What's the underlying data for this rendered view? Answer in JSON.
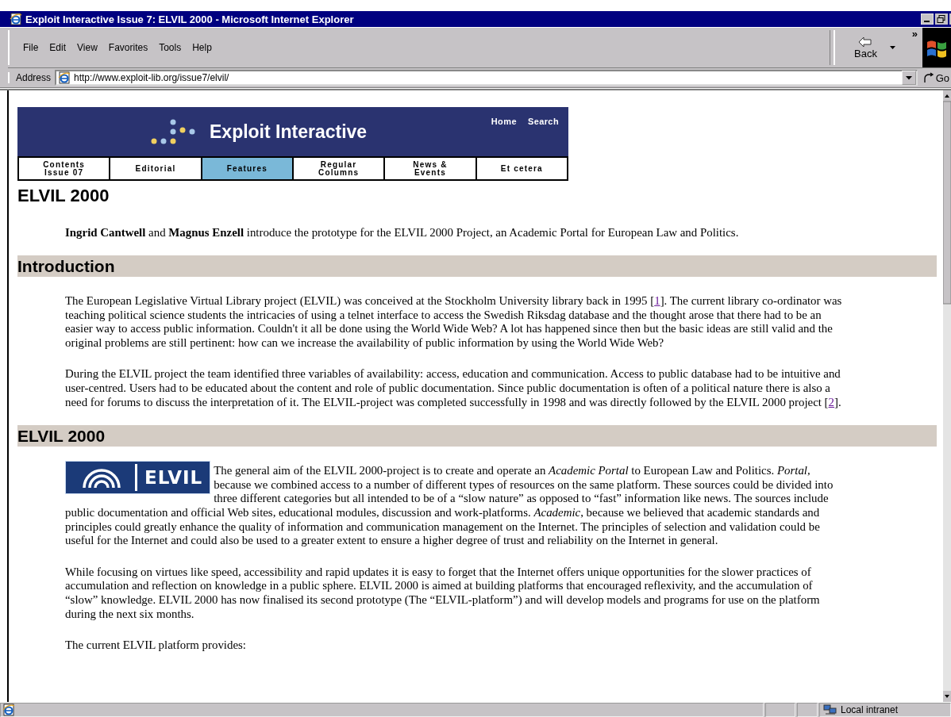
{
  "window": {
    "title": "Exploit Interactive Issue 7: ELVIL 2000 - Microsoft Internet Explorer"
  },
  "menu": [
    "File",
    "Edit",
    "View",
    "Favorites",
    "Tools",
    "Help"
  ],
  "toolbar": {
    "back_label": "Back",
    "chevron": "»"
  },
  "address": {
    "label": "Address",
    "value": "http://www.exploit-lib.org/issue7/elvil/",
    "go_label": "Go"
  },
  "banner": {
    "title": "Exploit Interactive",
    "links": [
      "Home",
      "Search"
    ],
    "tabs": [
      {
        "label": "Contents\nIssue 07",
        "selected": false
      },
      {
        "label": "Editorial",
        "selected": false
      },
      {
        "label": "Features",
        "selected": true
      },
      {
        "label": "Regular\nColumns",
        "selected": false
      },
      {
        "label": "News &\nEvents",
        "selected": false
      },
      {
        "label": "Et cetera",
        "selected": false
      }
    ]
  },
  "article": {
    "title": "ELVIL 2000",
    "byline": "**Ingrid Cantwell** and **Magnus Enzell** introduce the prototype for the ELVIL 2000 Project, an Academic Portal for European Law and Politics.",
    "sections": [
      {
        "heading": "Introduction",
        "paragraphs": [
          {
            "runs": [
              {
                "kind": "text",
                "text": "The European Legislative Virtual Library project (ELVIL) was conceived at the Stockholm University library back in 1995 ["
              },
              {
                "kind": "link",
                "text": "1"
              },
              {
                "kind": "text",
                "text": "]. The current library co-ordinator was teaching political science students the intricacies of using a telnet interface to access the Swedish Riksdag database and the thought arose that there had to be an easier way to access public information. Couldn't it all be done using the World Wide Web? A lot has happened since then but the basic ideas are still valid and the original problems are still pertinent: how can we increase the availability of public information by using the World Wide Web?"
              }
            ]
          },
          {
            "runs": [
              {
                "kind": "text",
                "text": "During the ELVIL project the team identified three variables of availability: access, education and communication. Access to public database had to be intuitive and user-centred. Users had to be educated about the content and role of public documentation. Since public documentation is often of a political nature there is also a need for forums to discuss the interpretation of it. The ELVIL-project was completed successfully in 1998 and was directly followed by the ELVIL 2000 project ["
              },
              {
                "kind": "link",
                "text": "2"
              },
              {
                "kind": "text",
                "text": "]."
              }
            ]
          }
        ]
      },
      {
        "heading": "ELVIL 2000",
        "logo": {
          "text": "ELVIL"
        },
        "paragraphs": [
          {
            "runs": [
              {
                "kind": "text",
                "text": "The general aim of the ELVIL 2000-project is to create and operate an *Academic Portal* to European Law and Politics. *Portal*, because we combined access to a number of different types of resources on the same platform. These sources could be divided into three different categories but all intended to be of a “slow nature” as opposed to “fast” information like news. The sources include public documentation and official Web sites, educational modules, discussion and work-platforms. *Academic*, because we believed that academic standards and principles could greatly enhance the quality of information and communication management on the Internet. The principles of selection and validation could be useful for the Internet and could also be used to a greater extent to ensure a higher degree of trust and reliability on the Internet in general."
              }
            ]
          },
          {
            "runs": [
              {
                "kind": "text",
                "text": "While focusing on virtues like speed, accessibility and rapid updates it is easy to forget that the Internet offers unique opportunities for the slower practices of accumulation and reflection on knowledge in a public sphere. ELVIL 2000 is aimed at building platforms that encouraged reflexivity, and the accumulation of “slow” knowledge. ELVIL 2000 has now finalised its second prototype (The “ELVIL-platform”) and will develop models and programs for use on the platform during the next six months."
              }
            ]
          },
          {
            "runs": [
              {
                "kind": "text",
                "text": "The current ELVIL platform provides:"
              }
            ]
          }
        ]
      }
    ]
  },
  "status_bar": {
    "zone": "Local intranet"
  }
}
